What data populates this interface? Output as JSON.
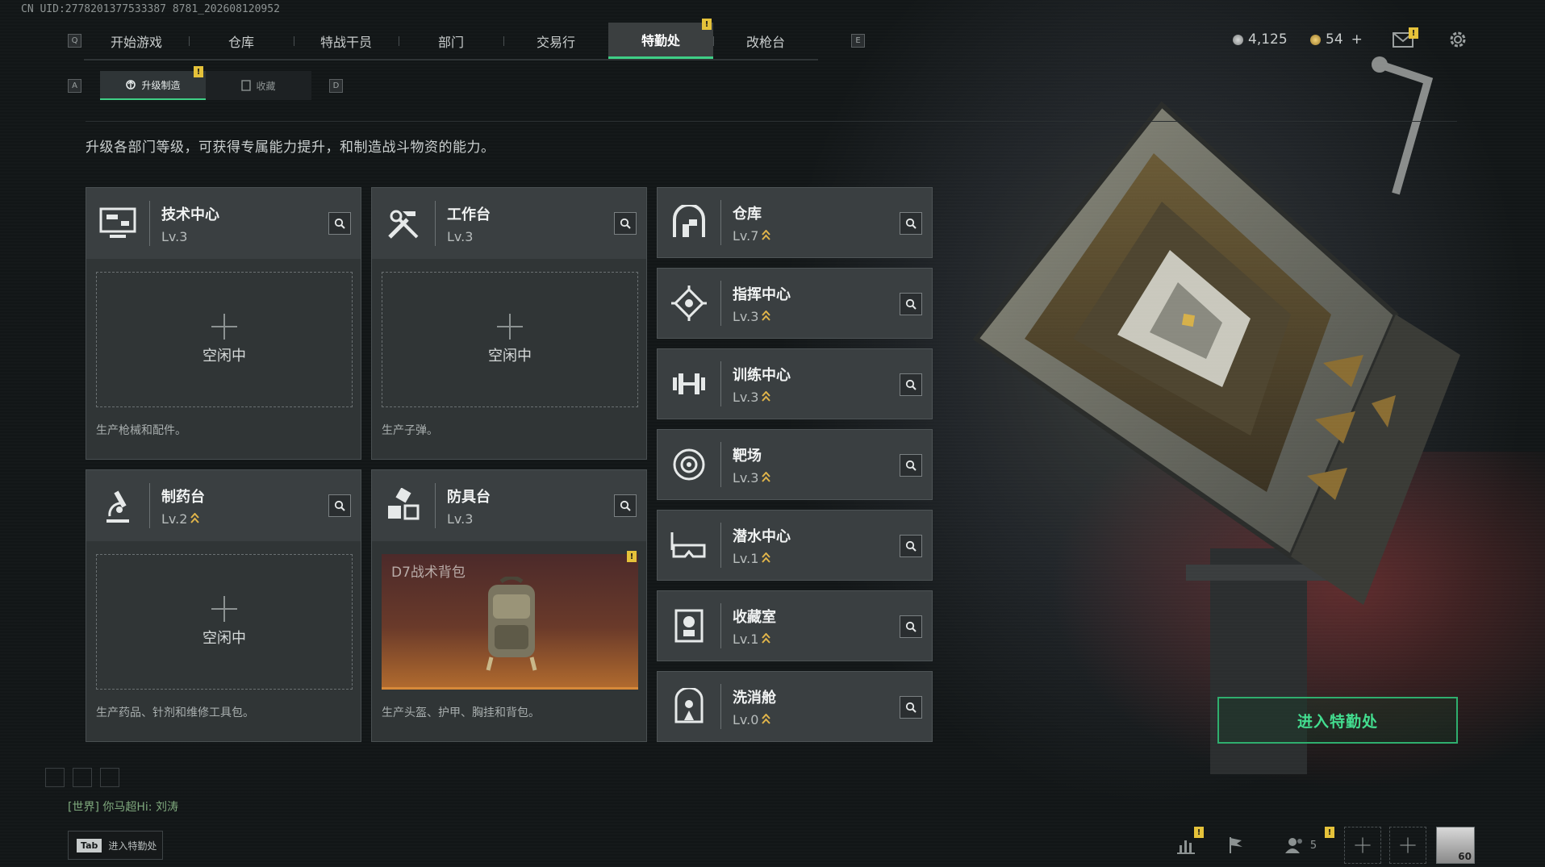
{
  "uid": "CN UID:2778201377533387 8781_202608120952",
  "topnav": {
    "left_key": "Q",
    "right_key": "E",
    "tabs": [
      {
        "label": "开始游戏",
        "active": false
      },
      {
        "label": "仓库",
        "active": false
      },
      {
        "label": "特战干员",
        "active": false
      },
      {
        "label": "部门",
        "active": false
      },
      {
        "label": "交易行",
        "active": false
      },
      {
        "label": "特勤处",
        "active": true,
        "badge": "!"
      },
      {
        "label": "改枪台",
        "active": false
      }
    ]
  },
  "currency": {
    "silver": "4,125",
    "gold": "54",
    "gold_plus": "+"
  },
  "subtabs": {
    "left_key": "A",
    "right_key": "D",
    "items": [
      {
        "label": "升级制造",
        "active": true,
        "badge": "!"
      },
      {
        "label": "收藏",
        "active": false
      }
    ]
  },
  "description": "升级各部门等级，可获得专属能力提升，和制造战斗物资的能力。",
  "production": [
    {
      "name": "技术中心",
      "level": "Lv.3",
      "upgradable": false,
      "status": "空闲中",
      "desc": "生产枪械和配件。",
      "icon": "computer-icon"
    },
    {
      "name": "工作台",
      "level": "Lv.3",
      "upgradable": false,
      "status": "空闲中",
      "desc": "生产子弹。",
      "icon": "tools-icon"
    },
    {
      "name": "制药台",
      "level": "Lv.2",
      "upgradable": true,
      "status": "空闲中",
      "desc": "生产药品、针剂和维修工具包。",
      "icon": "microscope-icon"
    },
    {
      "name": "防具台",
      "level": "Lv.3",
      "upgradable": false,
      "status": "",
      "product": "D7战术背包",
      "product_badge": "!",
      "desc": "生产头盔、护甲、胸挂和背包。",
      "icon": "cubes-icon"
    }
  ],
  "departments": [
    {
      "name": "仓库",
      "level": "Lv.7",
      "icon": "warehouse-icon"
    },
    {
      "name": "指挥中心",
      "level": "Lv.3",
      "icon": "command-icon"
    },
    {
      "name": "训练中心",
      "level": "Lv.3",
      "icon": "dumbbell-icon"
    },
    {
      "name": "靶场",
      "level": "Lv.3",
      "icon": "target-icon"
    },
    {
      "name": "潜水中心",
      "level": "Lv.1",
      "icon": "goggles-icon"
    },
    {
      "name": "收藏室",
      "level": "Lv.1",
      "icon": "trophy-icon"
    },
    {
      "name": "洗消舱",
      "level": "Lv.0",
      "icon": "decon-icon"
    }
  ],
  "enter_button": "进入特勤处",
  "chat": "[世界] 你马超Hi: 刘涛",
  "tab_hint": {
    "key": "Tab",
    "label": "进入特勤处"
  },
  "bottom": {
    "friends_count": "5",
    "player_level": "60",
    "badge": "!"
  }
}
